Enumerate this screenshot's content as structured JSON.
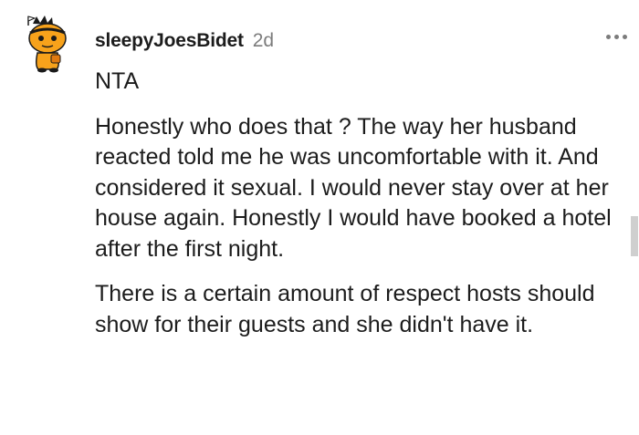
{
  "comment": {
    "username": "sleepyJoesBidet",
    "age": "2d",
    "paragraphs": [
      "NTA",
      "Honestly who does that ? The way her husband reacted told me he was uncomfortable with it. And considered it sexual. I would never stay over at her house again. Honestly I would have booked a hotel after the first night.",
      "There is a certain amount of respect hosts should show for their guests and she didn't have it."
    ]
  },
  "icons": {
    "avatar": "snoo-avatar-icon",
    "more": "more-options-icon"
  },
  "colors": {
    "text": "#1c1c1c",
    "meta": "#7c7c7c",
    "avatar_orange": "#f7a21b"
  }
}
